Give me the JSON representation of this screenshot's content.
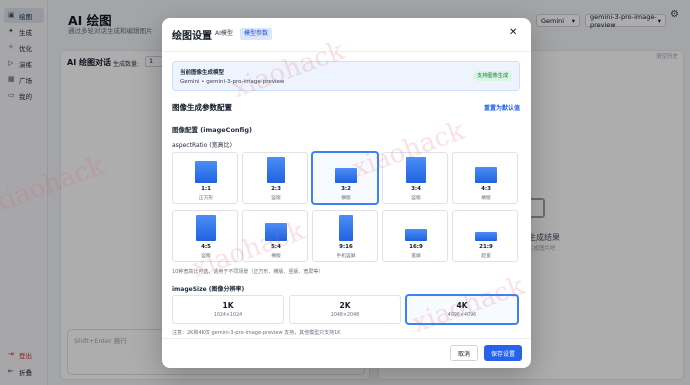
{
  "sidebar": {
    "items": [
      {
        "label": "绘图",
        "icon": "image-icon",
        "active": true
      },
      {
        "label": "生成",
        "icon": "sparkle-icon"
      },
      {
        "label": "优化",
        "icon": "wand-icon"
      },
      {
        "label": "演练",
        "icon": "play-icon"
      },
      {
        "label": "广场",
        "icon": "grid-icon"
      },
      {
        "label": "我的",
        "icon": "folder-icon"
      }
    ],
    "logout": "登出",
    "collapse": "折叠"
  },
  "header": {
    "title": "AI 绘图",
    "subtitle": "通过多轮对话生成和编辑图片",
    "provider": "Gemini",
    "model": "gemini-3-pro-image-preview"
  },
  "chat": {
    "title": "AI 绘图对话",
    "count_label": "生成数量:",
    "count_value": "1",
    "input_placeholder": "Shift+Enter 换行"
  },
  "result": {
    "clear": "清空历史",
    "empty_title": "生成结果",
    "empty_sub": "生成图片吧"
  },
  "modal": {
    "title": "绘图设置",
    "tabs": [
      "AI模型",
      "模型参数"
    ],
    "active_tab": 1,
    "info_label": "当前图像生成模型",
    "info_value": "Gemini • gemini-3-pro-image-preview",
    "info_badge": "支持图像生成",
    "section_title": "图像生成参数配置",
    "reset": "重置为默认值",
    "config_title": "图像配置 (imageConfig)",
    "aspect_label": "aspectRatio (宽高比)",
    "ratios": [
      {
        "value": "1:1",
        "desc": "正方形"
      },
      {
        "value": "2:3",
        "desc": "竖版"
      },
      {
        "value": "3:2",
        "desc": "横版"
      },
      {
        "value": "3:4",
        "desc": "竖版"
      },
      {
        "value": "4:3",
        "desc": "横版"
      },
      {
        "value": "4:5",
        "desc": "竖版"
      },
      {
        "value": "5:4",
        "desc": "横版"
      },
      {
        "value": "9:16",
        "desc": "手机竖屏"
      },
      {
        "value": "16:9",
        "desc": "宽屏"
      },
      {
        "value": "21:9",
        "desc": "超宽"
      }
    ],
    "selected_ratio": "3:2",
    "ratio_note": "10种宽高比可选，适用于不同场景（正方形、横版、竖版、宽屏等）",
    "size_label": "imageSize (图像分辨率)",
    "sizes": [
      {
        "name": "1K",
        "dim": "1024×1024"
      },
      {
        "name": "2K",
        "dim": "2048×2048"
      },
      {
        "name": "4K",
        "dim": "4096×4096"
      }
    ],
    "selected_size": "4K",
    "size_note": "注意：2K和4K仅 gemini-3-pro-image-preview 支持，其他模型只支持1K",
    "cancel": "取消",
    "save": "保存设置"
  },
  "watermark": "xiaohack"
}
